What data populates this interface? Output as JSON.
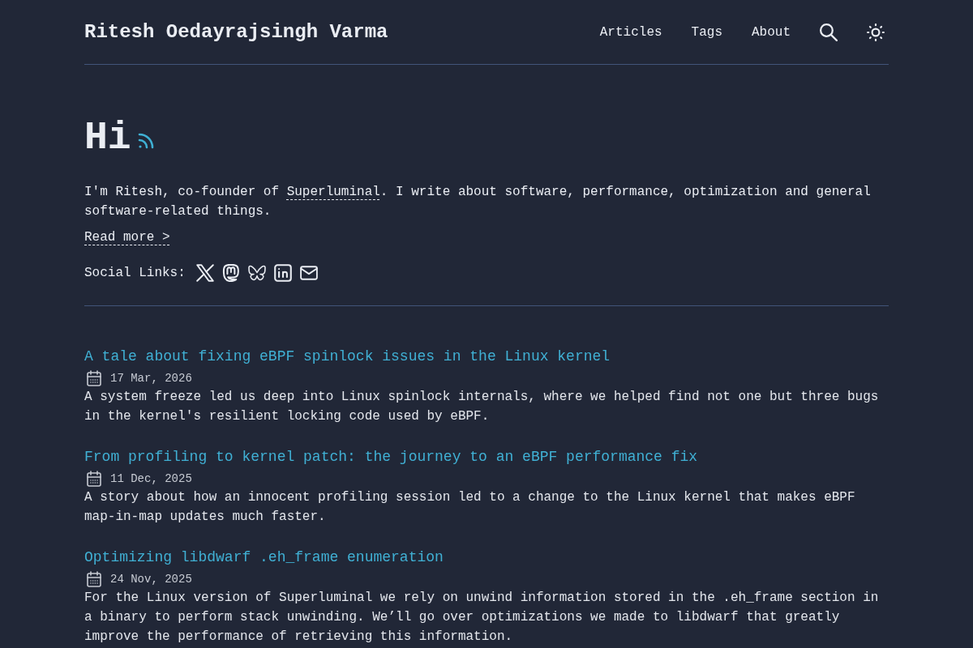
{
  "header": {
    "site_title": "Ritesh Oedayrajsingh Varma",
    "nav": [
      {
        "label": "Articles"
      },
      {
        "label": "Tags"
      },
      {
        "label": "About"
      }
    ]
  },
  "hero": {
    "heading": "Hi",
    "intro": {
      "before": "I'm Ritesh, co-founder of ",
      "link": "Superluminal",
      "after": ". I write about software, performance, optimization and general software-related things."
    },
    "read_more": "Read more >",
    "social": {
      "label": "Social Links:",
      "links": [
        {
          "kind": "x"
        },
        {
          "kind": "mastodon"
        },
        {
          "kind": "bluesky"
        },
        {
          "kind": "linkedin"
        },
        {
          "kind": "email"
        }
      ]
    }
  },
  "articles": [
    {
      "title": "A tale about fixing eBPF spinlock issues in the Linux kernel",
      "date": "17 Mar, 2026",
      "description": "A system freeze led us deep into Linux spinlock internals, where we helped find not one but three bugs in the kernel's resilient locking code used by eBPF."
    },
    {
      "title": "From profiling to kernel patch: the journey to an eBPF performance fix",
      "date": "11 Dec, 2025",
      "description": "A story about how an innocent profiling session led to a change to the Linux kernel that makes eBPF map-in-map updates much faster."
    },
    {
      "title": "Optimizing libdwarf .eh_frame enumeration",
      "date": "24 Nov, 2025",
      "description": "For the Linux version of Superluminal we rely on unwind information stored in the .eh_frame section in a binary to perform stack unwinding. We’ll go over optimizations we made to libdwarf that greatly improve the performance of retrieving this information."
    }
  ]
}
